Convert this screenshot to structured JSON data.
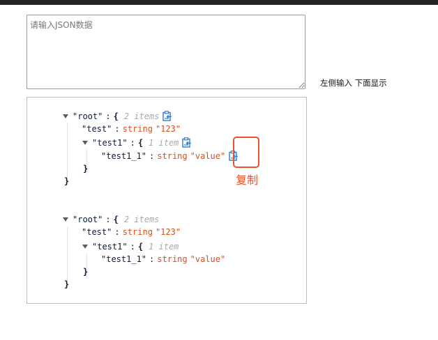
{
  "input": {
    "placeholder": "请输入JSON数据"
  },
  "hint": "左侧输入 下面显示",
  "annotation": "复制",
  "trees": [
    {
      "root_key": "\"root\"",
      "root_meta": "2 items",
      "test_key": "\"test\"",
      "test_type": "string",
      "test_value": "\"123\"",
      "test1_key": "\"test1\"",
      "test1_meta": "1 item",
      "test1_1_key": "\"test1_1\"",
      "test1_1_type": "string",
      "test1_1_value": "\"value\""
    },
    {
      "root_key": "\"root\"",
      "root_meta": "2 items",
      "test_key": "\"test\"",
      "test_type": "string",
      "test_value": "\"123\"",
      "test1_key": "\"test1\"",
      "test1_meta": "1 item",
      "test1_1_key": "\"test1_1\"",
      "test1_1_type": "string",
      "test1_1_value": "\"value\""
    }
  ],
  "colors": {
    "accent": "#e9522c",
    "string": "#d64f1e",
    "copy_icon": "#2a7ed3",
    "meta": "#a9a9a9"
  },
  "icons": [
    "caret-down-icon",
    "copy-icon"
  ]
}
